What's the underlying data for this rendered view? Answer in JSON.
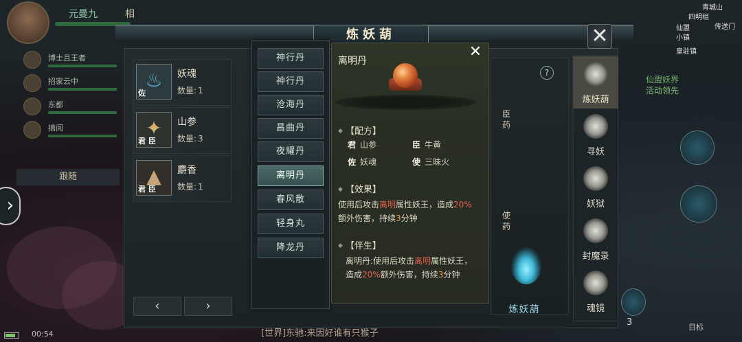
{
  "hud": {
    "player_name": "元曼九",
    "player_title": "相",
    "team": [
      {
        "name": "博士且王者"
      },
      {
        "name": "招家云中"
      },
      {
        "name": "东都"
      },
      {
        "name": "摘阅"
      }
    ],
    "follow_label": "跟随",
    "clock": "00:54",
    "chat_text": "[世界]东驰:来因好谁有只猴子",
    "right_labels": [
      "青城山",
      "四明组",
      "小镇",
      "仙盟",
      "皇驻镇",
      "传送门"
    ],
    "event_text": [
      "仙盟妖界",
      "活动领先"
    ],
    "target_label": "目标",
    "skill_cd": "3"
  },
  "window": {
    "title": "炼妖葫",
    "close_label": "✕"
  },
  "materials": [
    {
      "name": "妖魂",
      "qty_label": "数量:",
      "qty": "1",
      "roles": "佐",
      "glyph": "🔥",
      "glyph_color": "#5ab8e8"
    },
    {
      "name": "山参",
      "qty_label": "数量:",
      "qty": "3",
      "roles": "君 臣",
      "glyph": "✦",
      "glyph_color": "#d8b070"
    },
    {
      "name": "麝香",
      "qty_label": "数量:",
      "qty": "1",
      "roles": "君 臣",
      "glyph": "▲",
      "glyph_color": "#c8a478"
    }
  ],
  "pager": {
    "prev": "‹",
    "next": "›"
  },
  "recipes": [
    {
      "label": "神行丹",
      "active": false
    },
    {
      "label": "神行丹",
      "active": false
    },
    {
      "label": "沧海丹",
      "active": false
    },
    {
      "label": "昌曲丹",
      "active": false
    },
    {
      "label": "夜耀丹",
      "active": false
    },
    {
      "label": "离明丹",
      "active": true
    },
    {
      "label": "春风散",
      "active": false
    },
    {
      "label": "轻身丸",
      "active": false
    },
    {
      "label": "降龙丹",
      "active": false
    }
  ],
  "detail": {
    "title": "离明丹",
    "close_label": "✕",
    "formula_head": "【配方】",
    "formula": [
      {
        "role": "君",
        "item": "山参"
      },
      {
        "role": "臣",
        "item": "牛黄"
      },
      {
        "role": "佐",
        "item": "妖魂"
      },
      {
        "role": "使",
        "item": "三昧火"
      }
    ],
    "effect_head": "【效果】",
    "effect": {
      "p1": "使用后攻击",
      "hl1": "离明",
      "p2": "属性妖王，造成",
      "hl2": "20%",
      "p3": "额外伤害，持续",
      "hl3": "3",
      "p4": "分钟"
    },
    "companion_head": "【伴生】",
    "companion": {
      "p1": "离明丹:使用后攻击",
      "hl1": "离明",
      "p2": "属性妖王，造成",
      "hl2": "20%",
      "p3": "额外伤害，持续",
      "hl3": "3",
      "p4": "分钟"
    }
  },
  "furnace": {
    "help": "?",
    "label_minister": "臣药",
    "label_envoy": "使药",
    "button": "炼妖葫"
  },
  "nav": [
    {
      "label": "炼妖葫",
      "active": true
    },
    {
      "label": "寻妖",
      "active": false
    },
    {
      "label": "妖狱",
      "active": false
    },
    {
      "label": "封魔录",
      "active": false
    },
    {
      "label": "魂镜",
      "active": false
    }
  ],
  "colors": {
    "highlight_red": "#e0604a",
    "highlight_orange": "#e8a050",
    "active_tab": "#4c6a68"
  }
}
